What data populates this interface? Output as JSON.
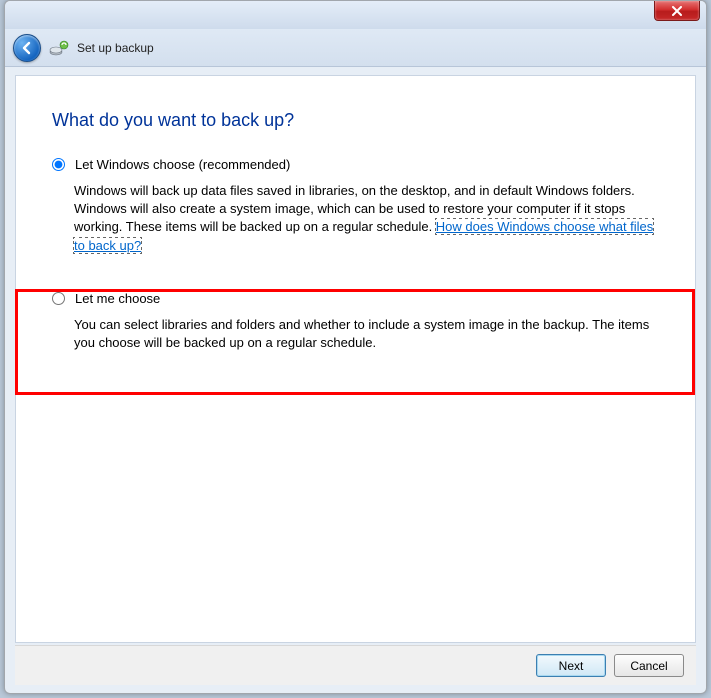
{
  "window": {
    "title": "Set up backup"
  },
  "page": {
    "heading": "What do you want to back up?"
  },
  "options": [
    {
      "label": "Let Windows choose (recommended)",
      "description": "Windows will back up data files saved in libraries, on the desktop, and in default Windows folders. Windows will also create a system image, which can be used to restore your computer if it stops working. These items will be backed up on a regular schedule. ",
      "link_text": "How does Windows choose what files to back up?",
      "selected": true
    },
    {
      "label": "Let me choose",
      "description": "You can select libraries and folders and whether to include a system image in the backup. The items you choose will be backed up on a regular schedule.",
      "link_text": "",
      "selected": false
    }
  ],
  "buttons": {
    "next": "Next",
    "cancel": "Cancel"
  },
  "annotation": {
    "highlighted_option_index": 1
  }
}
